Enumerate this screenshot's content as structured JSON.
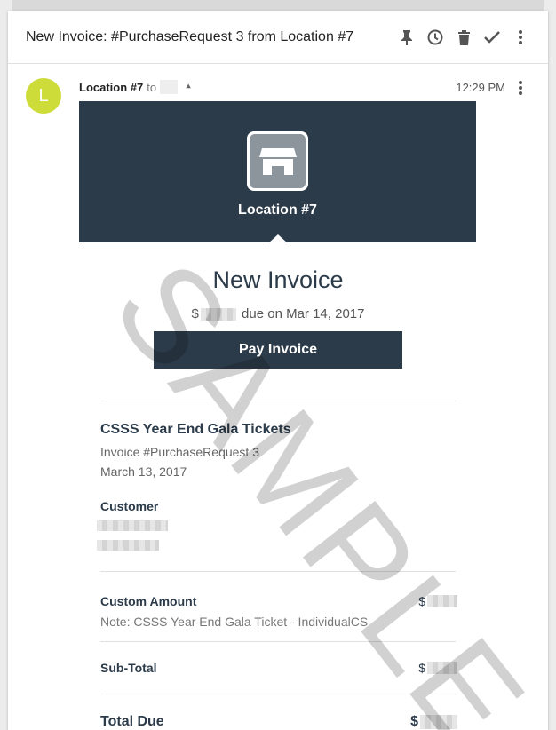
{
  "email": {
    "subject": "New Invoice: #PurchaseRequest 3 from Location #7",
    "toolbar_icons": [
      "pin-icon",
      "snooze-icon",
      "delete-icon",
      "done-icon",
      "more-icon"
    ],
    "avatar_letter": "L",
    "avatar_color": "#cddc39",
    "sender": "Location #7",
    "to_label": "to",
    "time": "12:29 PM"
  },
  "invoice": {
    "merchant": "Location #7",
    "title": "New Invoice",
    "currency": "$",
    "due_text": "due on Mar 14, 2017",
    "pay_button": "Pay Invoice",
    "item_title": "CSSS Year End Gala Tickets",
    "invoice_number": "Invoice #PurchaseRequest 3",
    "date": "March 13, 2017",
    "customer_label": "Customer",
    "line_label": "Custom Amount",
    "line_note": "Note: CSSS Year End Gala Ticket - IndividualCS",
    "subtotal_label": "Sub-Total",
    "total_label": "Total Due",
    "banner_color": "#2c3b4a"
  },
  "watermark": "SAMPLE"
}
